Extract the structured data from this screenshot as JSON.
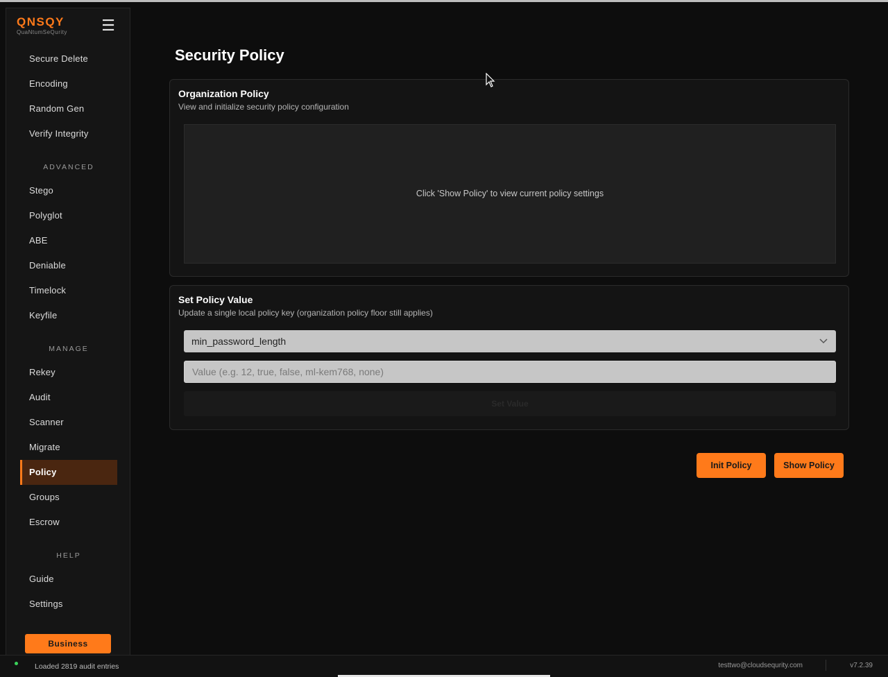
{
  "app": {
    "logo_main": "QNSQY",
    "logo_sub": "QuaNtumSeQurity",
    "menu_icon": "☰",
    "plan_label": "Business"
  },
  "sidebar": {
    "items_top": [
      "Secure Delete",
      "Encoding",
      "Random Gen",
      "Verify Integrity"
    ],
    "sections": {
      "advanced": "ADVANCED",
      "manage": "MANAGE",
      "help": "HELP"
    },
    "advanced_items": [
      "Stego",
      "Polyglot",
      "ABE",
      "Deniable",
      "Timelock",
      "Keyfile"
    ],
    "manage_items": [
      "Rekey",
      "Audit",
      "Scanner",
      "Migrate",
      "Policy",
      "Groups",
      "Escrow"
    ],
    "help_items": [
      "Guide",
      "Settings"
    ],
    "active_item": "Policy"
  },
  "main": {
    "title": "Security Policy",
    "org_card": {
      "title": "Organization Policy",
      "subtitle": "View and initialize security policy configuration",
      "message": "Click 'Show Policy' to view current policy settings"
    },
    "set_card": {
      "title": "Set Policy Value",
      "subtitle": "Update a single local policy key (organization policy floor still applies)",
      "select_value": "min_password_length",
      "value_placeholder": "Value (e.g. 12, true, false, ml-kem768, none)",
      "set_button": "Set Value"
    },
    "actions": {
      "init_policy": "Init Policy",
      "show_policy": "Show Policy"
    }
  },
  "status": {
    "message": "Loaded 2819 audit entries",
    "user": "testtwo@cloudsequrity.com",
    "version": "v7.2.39"
  },
  "colors": {
    "accent": "#ff7a1a",
    "background": "#0d0d0d",
    "active_nav_bg": "#4a2610",
    "status_dot": "#3ad35a"
  }
}
